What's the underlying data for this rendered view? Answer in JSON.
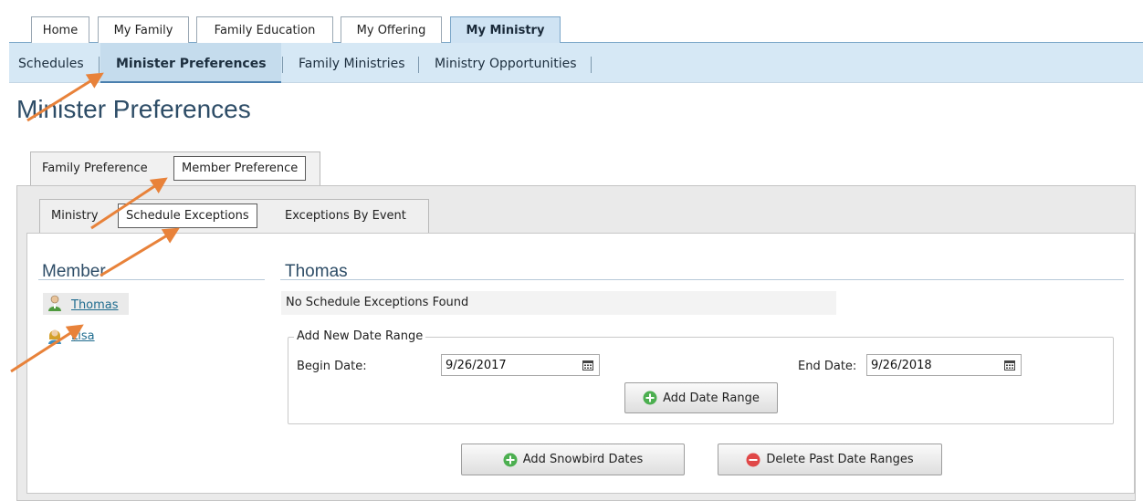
{
  "top_tabs": [
    {
      "label": "Home"
    },
    {
      "label": "My Family"
    },
    {
      "label": "Family Education"
    },
    {
      "label": "My Offering"
    },
    {
      "label": "My Ministry"
    }
  ],
  "subnav": [
    {
      "label": "Schedules"
    },
    {
      "label": "Minister Preferences"
    },
    {
      "label": "Family Ministries"
    },
    {
      "label": "Ministry Opportunities"
    }
  ],
  "page_title": "Minister Preferences",
  "pref_tabs": [
    {
      "label": "Family Preference"
    },
    {
      "label": "Member Preference"
    }
  ],
  "sub_tabs": [
    {
      "label": "Ministry"
    },
    {
      "label": "Schedule Exceptions"
    },
    {
      "label": "Exceptions By Event"
    }
  ],
  "members": {
    "header": "Member",
    "items": [
      {
        "name": "Thomas"
      },
      {
        "name": "Lisa"
      }
    ]
  },
  "detail": {
    "title": "Thomas",
    "message": "No Schedule Exceptions Found",
    "range": {
      "legend": "Add New Date Range",
      "begin_label": "Begin Date:",
      "begin_value": "9/26/2017",
      "end_label": "End Date:",
      "end_value": "9/26/2018",
      "add_button": "Add Date Range"
    },
    "snowbird_button": "Add Snowbird Dates",
    "delete_button": "Delete Past Date Ranges"
  },
  "colors": {
    "nav_bg": "#d6e8f5",
    "title": "#2e4d67",
    "link": "#1f6c8f",
    "arrow": "#e8823a",
    "add_icon": "#4caf50",
    "delete_icon": "#e04848"
  }
}
